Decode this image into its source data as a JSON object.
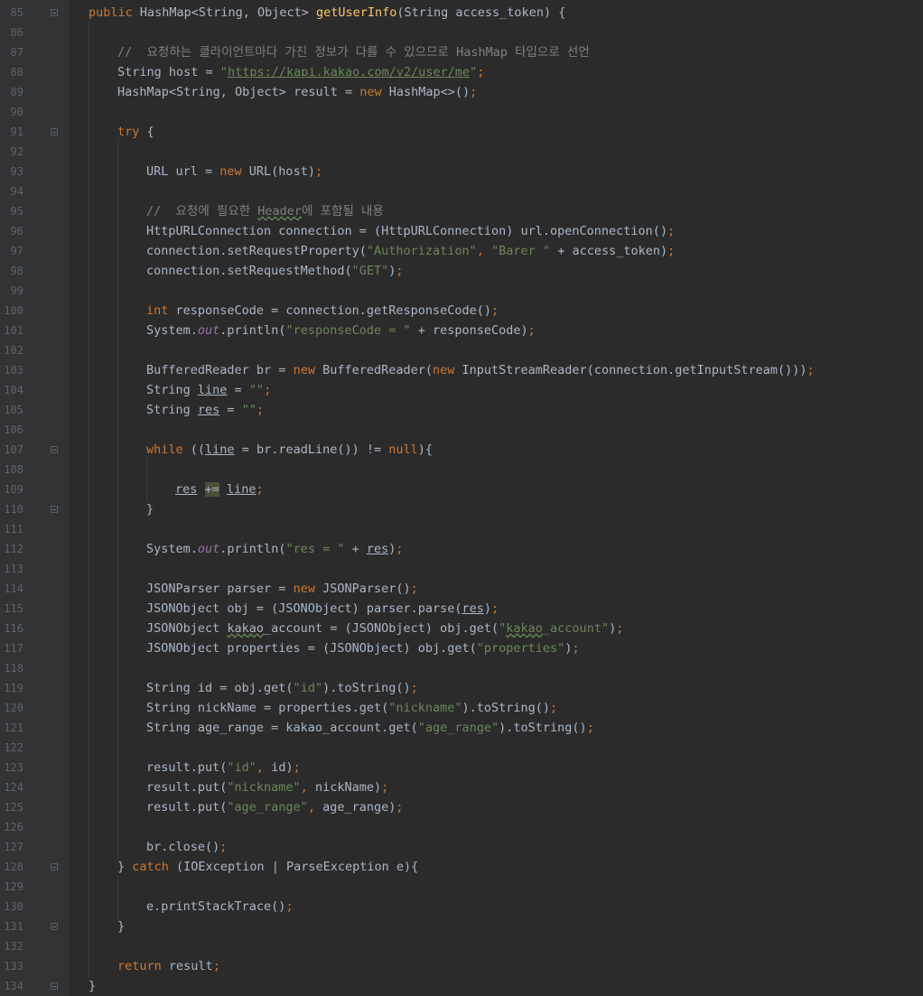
{
  "editor": {
    "colors": {
      "background": "#2b2b2b",
      "gutter": "#313335",
      "line_number": "#606366",
      "keyword": "#cc7832",
      "string": "#6a8759",
      "comment": "#808080",
      "method_declaration": "#ffc66d",
      "static_field": "#9876aa",
      "default_text": "#a9b7c6"
    },
    "lines": [
      {
        "n": "85",
        "fold": true,
        "indent": 0,
        "tokens": [
          [
            "kw",
            "public "
          ],
          [
            "",
            "HashMap<String, Object> "
          ],
          [
            "fn",
            "getUserInfo"
          ],
          [
            "",
            "(String access_token) {"
          ]
        ]
      },
      {
        "n": "86",
        "indent": 0,
        "tokens": []
      },
      {
        "n": "87",
        "indent": 1,
        "tokens": [
          [
            "cmt",
            "//  요청하는 클라이언트마다 가진 정보가 다를 수 있으므로 HashMap 타입으로 선언"
          ]
        ]
      },
      {
        "n": "88",
        "indent": 1,
        "tokens": [
          [
            "",
            "String host = "
          ],
          [
            "str",
            "\""
          ],
          [
            "str url",
            "https://kapi.kakao.com/v2/user/me"
          ],
          [
            "str",
            "\""
          ],
          [
            "kw",
            ";"
          ]
        ]
      },
      {
        "n": "89",
        "indent": 1,
        "tokens": [
          [
            "",
            "HashMap<String, Object> result = "
          ],
          [
            "kw",
            "new "
          ],
          [
            "",
            "HashMap<>()"
          ],
          [
            "kw",
            ";"
          ]
        ]
      },
      {
        "n": "90",
        "indent": 0,
        "tokens": []
      },
      {
        "n": "91",
        "fold": true,
        "indent": 1,
        "tokens": [
          [
            "kw",
            "try "
          ],
          [
            "",
            "{"
          ]
        ]
      },
      {
        "n": "92",
        "indent": 0,
        "tokens": []
      },
      {
        "n": "93",
        "indent": 2,
        "tokens": [
          [
            "",
            "URL url = "
          ],
          [
            "kw",
            "new "
          ],
          [
            "",
            "URL(host)"
          ],
          [
            "kw",
            ";"
          ]
        ]
      },
      {
        "n": "94",
        "indent": 0,
        "tokens": []
      },
      {
        "n": "95",
        "indent": 2,
        "tokens": [
          [
            "cmt",
            "//  요청에 필요한 "
          ],
          [
            "cmt warn",
            "Header"
          ],
          [
            "cmt",
            "에 포함될 내용"
          ]
        ]
      },
      {
        "n": "96",
        "indent": 2,
        "tokens": [
          [
            "",
            "HttpURLConnection connection = (HttpURLConnection) url.openConnection()"
          ],
          [
            "kw",
            ";"
          ]
        ]
      },
      {
        "n": "97",
        "indent": 2,
        "tokens": [
          [
            "",
            "connection.setRequestProperty("
          ],
          [
            "str",
            "\"Authorization\""
          ],
          [
            "kw",
            ", "
          ],
          [
            "str",
            "\"Barer \""
          ],
          [
            "",
            " + access_token)"
          ],
          [
            "kw",
            ";"
          ]
        ]
      },
      {
        "n": "98",
        "indent": 2,
        "tokens": [
          [
            "",
            "connection.setRequestMethod("
          ],
          [
            "str",
            "\"GET\""
          ],
          [
            "",
            ")"
          ],
          [
            "kw",
            ";"
          ]
        ]
      },
      {
        "n": "99",
        "indent": 0,
        "tokens": []
      },
      {
        "n": "100",
        "indent": 2,
        "tokens": [
          [
            "kw",
            "int "
          ],
          [
            "",
            "responseCode = connection.getResponseCode()"
          ],
          [
            "kw",
            ";"
          ]
        ]
      },
      {
        "n": "101",
        "indent": 2,
        "tokens": [
          [
            "",
            "System."
          ],
          [
            "it",
            "out"
          ],
          [
            "",
            ".println("
          ],
          [
            "str",
            "\"responseCode = \""
          ],
          [
            "",
            " + responseCode)"
          ],
          [
            "kw",
            ";"
          ]
        ]
      },
      {
        "n": "102",
        "indent": 0,
        "tokens": []
      },
      {
        "n": "103",
        "indent": 2,
        "tokens": [
          [
            "",
            "BufferedReader br = "
          ],
          [
            "kw",
            "new "
          ],
          [
            "",
            "BufferedReader("
          ],
          [
            "kw",
            "new "
          ],
          [
            "",
            "InputStreamReader(connection.getInputStream()))"
          ],
          [
            "kw",
            ";"
          ]
        ]
      },
      {
        "n": "104",
        "indent": 2,
        "tokens": [
          [
            "",
            "String "
          ],
          [
            "un",
            "line"
          ],
          [
            "",
            " = "
          ],
          [
            "str",
            "\"\""
          ],
          [
            "kw",
            ";"
          ]
        ]
      },
      {
        "n": "105",
        "indent": 2,
        "tokens": [
          [
            "",
            "String "
          ],
          [
            "un",
            "res"
          ],
          [
            "",
            " = "
          ],
          [
            "str",
            "\"\""
          ],
          [
            "kw",
            ";"
          ]
        ]
      },
      {
        "n": "106",
        "indent": 0,
        "tokens": []
      },
      {
        "n": "107",
        "fold": true,
        "indent": 2,
        "tokens": [
          [
            "kw",
            "while "
          ],
          [
            "",
            "(("
          ],
          [
            "un",
            "line"
          ],
          [
            "",
            " = br.readLine()) != "
          ],
          [
            "kw",
            "null"
          ],
          [
            "",
            "){"
          ]
        ]
      },
      {
        "n": "108",
        "indent": 0,
        "tokens": []
      },
      {
        "n": "109",
        "indent": 3,
        "tokens": [
          [
            "un",
            "res"
          ],
          [
            "",
            " "
          ],
          [
            "hl",
            "+="
          ],
          [
            "",
            " "
          ],
          [
            "un",
            "line"
          ],
          [
            "kw",
            ";"
          ]
        ]
      },
      {
        "n": "110",
        "fold": true,
        "indent": 2,
        "tokens": [
          [
            "",
            "}"
          ]
        ]
      },
      {
        "n": "111",
        "indent": 0,
        "tokens": []
      },
      {
        "n": "112",
        "indent": 2,
        "tokens": [
          [
            "",
            "System."
          ],
          [
            "it",
            "out"
          ],
          [
            "",
            ".println("
          ],
          [
            "str",
            "\"res = \""
          ],
          [
            "",
            " + "
          ],
          [
            "un",
            "res"
          ],
          [
            "",
            ")"
          ],
          [
            "kw",
            ";"
          ]
        ]
      },
      {
        "n": "113",
        "indent": 0,
        "tokens": []
      },
      {
        "n": "114",
        "indent": 2,
        "tokens": [
          [
            "",
            "JSONParser parser = "
          ],
          [
            "kw",
            "new "
          ],
          [
            "",
            "JSONParser()"
          ],
          [
            "kw",
            ";"
          ]
        ]
      },
      {
        "n": "115",
        "indent": 2,
        "tokens": [
          [
            "",
            "JSONObject obj = (JSONObject) parser.parse("
          ],
          [
            "un",
            "res"
          ],
          [
            "",
            ")"
          ],
          [
            "kw",
            ";"
          ]
        ]
      },
      {
        "n": "116",
        "indent": 2,
        "tokens": [
          [
            "",
            "JSONObject "
          ],
          [
            "warn",
            "kakao"
          ],
          [
            "",
            "_account = (JSONObject) obj.get("
          ],
          [
            "str",
            "\""
          ],
          [
            "str warn",
            "kakao"
          ],
          [
            "str",
            "_account\""
          ],
          [
            "",
            ")"
          ],
          [
            "kw",
            ";"
          ]
        ]
      },
      {
        "n": "117",
        "indent": 2,
        "tokens": [
          [
            "",
            "JSONObject properties = (JSONObject) obj.get("
          ],
          [
            "str",
            "\"properties\""
          ],
          [
            "",
            ")"
          ],
          [
            "kw",
            ";"
          ]
        ]
      },
      {
        "n": "118",
        "indent": 0,
        "tokens": []
      },
      {
        "n": "119",
        "indent": 2,
        "tokens": [
          [
            "",
            "String id = obj.get("
          ],
          [
            "str",
            "\"id\""
          ],
          [
            "",
            ").toString()"
          ],
          [
            "kw",
            ";"
          ]
        ]
      },
      {
        "n": "120",
        "indent": 2,
        "tokens": [
          [
            "",
            "String nickName = properties.get("
          ],
          [
            "str",
            "\"nickname\""
          ],
          [
            "",
            ").toString()"
          ],
          [
            "kw",
            ";"
          ]
        ]
      },
      {
        "n": "121",
        "indent": 2,
        "tokens": [
          [
            "",
            "String age_range = kakao_account.get("
          ],
          [
            "str",
            "\"age_range\""
          ],
          [
            "",
            ").toString()"
          ],
          [
            "kw",
            ";"
          ]
        ]
      },
      {
        "n": "122",
        "indent": 0,
        "tokens": []
      },
      {
        "n": "123",
        "indent": 2,
        "tokens": [
          [
            "",
            "result.put("
          ],
          [
            "str",
            "\"id\""
          ],
          [
            "kw",
            ", "
          ],
          [
            "",
            "id)"
          ],
          [
            "kw",
            ";"
          ]
        ]
      },
      {
        "n": "124",
        "indent": 2,
        "tokens": [
          [
            "",
            "result.put("
          ],
          [
            "str",
            "\"nickname\""
          ],
          [
            "kw",
            ", "
          ],
          [
            "",
            "nickName)"
          ],
          [
            "kw",
            ";"
          ]
        ]
      },
      {
        "n": "125",
        "indent": 2,
        "tokens": [
          [
            "",
            "result.put("
          ],
          [
            "str",
            "\"age_range\""
          ],
          [
            "kw",
            ", "
          ],
          [
            "",
            "age_range)"
          ],
          [
            "kw",
            ";"
          ]
        ]
      },
      {
        "n": "126",
        "indent": 0,
        "tokens": []
      },
      {
        "n": "127",
        "indent": 2,
        "tokens": [
          [
            "",
            "br.close()"
          ],
          [
            "kw",
            ";"
          ]
        ]
      },
      {
        "n": "128",
        "fold": true,
        "indent": 1,
        "tokens": [
          [
            "",
            "} "
          ],
          [
            "kw",
            "catch "
          ],
          [
            "",
            "(IOException | ParseException e){"
          ]
        ]
      },
      {
        "n": "129",
        "indent": 0,
        "tokens": []
      },
      {
        "n": "130",
        "indent": 2,
        "tokens": [
          [
            "",
            "e.printStackTrace()"
          ],
          [
            "kw",
            ";"
          ]
        ]
      },
      {
        "n": "131",
        "fold": true,
        "indent": 1,
        "tokens": [
          [
            "",
            "}"
          ]
        ]
      },
      {
        "n": "132",
        "indent": 0,
        "tokens": []
      },
      {
        "n": "133",
        "indent": 1,
        "tokens": [
          [
            "kw",
            "return "
          ],
          [
            "",
            "result"
          ],
          [
            "kw",
            ";"
          ]
        ]
      },
      {
        "n": "134",
        "fold": true,
        "indent": 0,
        "tokens": [
          [
            "",
            "}"
          ]
        ]
      }
    ]
  }
}
